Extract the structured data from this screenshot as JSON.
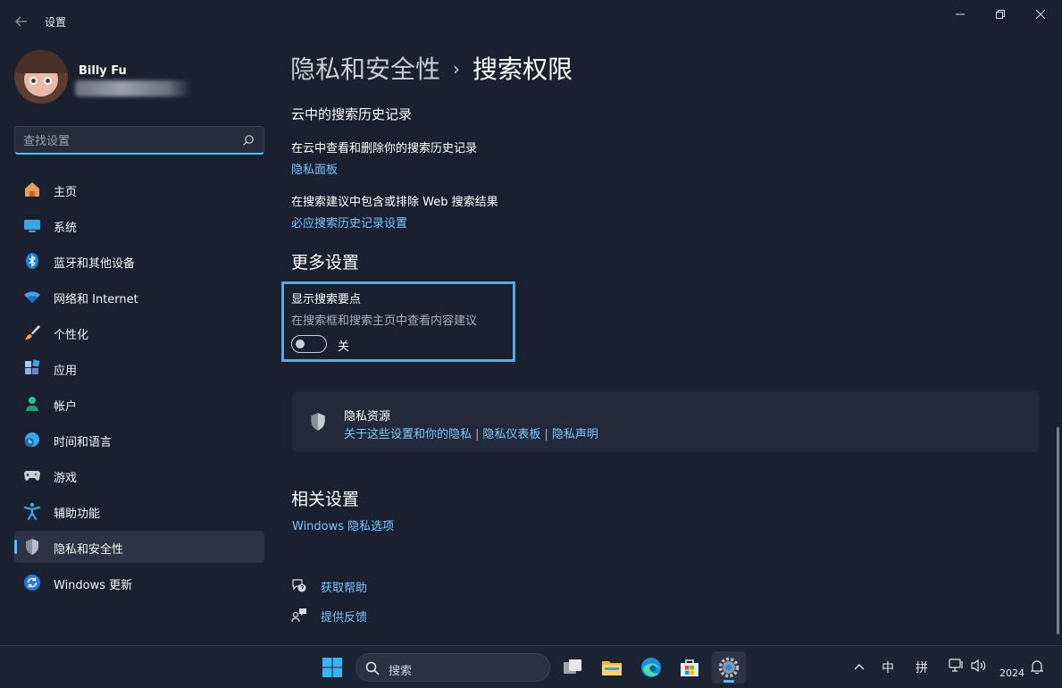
{
  "window": {
    "title": "设置",
    "back_icon": "back-arrow-icon",
    "controls": [
      "minimize-icon",
      "restore-icon",
      "close-icon"
    ]
  },
  "user": {
    "name": "Billy Fu"
  },
  "search": {
    "placeholder": "查找设置",
    "icon": "search-icon"
  },
  "sidebar": {
    "items": [
      {
        "label": "主页",
        "icon": "home-icon",
        "active": false
      },
      {
        "label": "系统",
        "icon": "display-icon",
        "active": false
      },
      {
        "label": "蓝牙和其他设备",
        "icon": "bluetooth-icon",
        "active": false
      },
      {
        "label": "网络和 Internet",
        "icon": "wifi-icon",
        "active": false
      },
      {
        "label": "个性化",
        "icon": "brush-icon",
        "active": false
      },
      {
        "label": "应用",
        "icon": "apps-icon",
        "active": false
      },
      {
        "label": "帐户",
        "icon": "person-icon",
        "active": false
      },
      {
        "label": "时间和语言",
        "icon": "clock-globe-icon",
        "active": false
      },
      {
        "label": "游戏",
        "icon": "gamepad-icon",
        "active": false
      },
      {
        "label": "辅助功能",
        "icon": "accessibility-icon",
        "active": false
      },
      {
        "label": "隐私和安全性",
        "icon": "shield-icon",
        "active": true
      },
      {
        "label": "Windows 更新",
        "icon": "update-icon",
        "active": false
      }
    ]
  },
  "breadcrumb": {
    "parent": "隐私和安全性",
    "separator": "›",
    "current": "搜索权限"
  },
  "cloud_history": {
    "heading": "云中的搜索历史记录",
    "item1_text": "在云中查看和删除你的搜索历史记录",
    "item1_link": "隐私面板",
    "item2_text": "在搜索建议中包含或排除 Web 搜索结果",
    "item2_link": "必应搜索历史记录设置"
  },
  "more_settings": {
    "heading": "更多设置",
    "highlights_title": "显示搜索要点",
    "highlights_desc": "在搜索框和搜索主页中查看内容建议",
    "toggle_state": "关",
    "toggle_on": false
  },
  "privacy_resources": {
    "title": "隐私资源",
    "links": [
      "关于这些设置和你的隐私",
      "隐私仪表板",
      "隐私声明"
    ],
    "separator": "|"
  },
  "related": {
    "heading": "相关设置",
    "link": "Windows 隐私选项"
  },
  "help": {
    "get_help": "获取帮助",
    "feedback": "提供反馈"
  },
  "taskbar": {
    "search_label": "搜索",
    "apps": [
      "start-icon",
      "task-view-icon",
      "file-explorer-icon",
      "edge-icon",
      "store-icon",
      "settings-icon"
    ],
    "tray": {
      "ime_lang": "中",
      "ime_mode": "拼",
      "clock": "2024"
    }
  },
  "colors": {
    "accent": "#4cc2ff",
    "link": "#79c8ff",
    "background": "#1a2030",
    "highlight_border": "#5aa8de"
  }
}
